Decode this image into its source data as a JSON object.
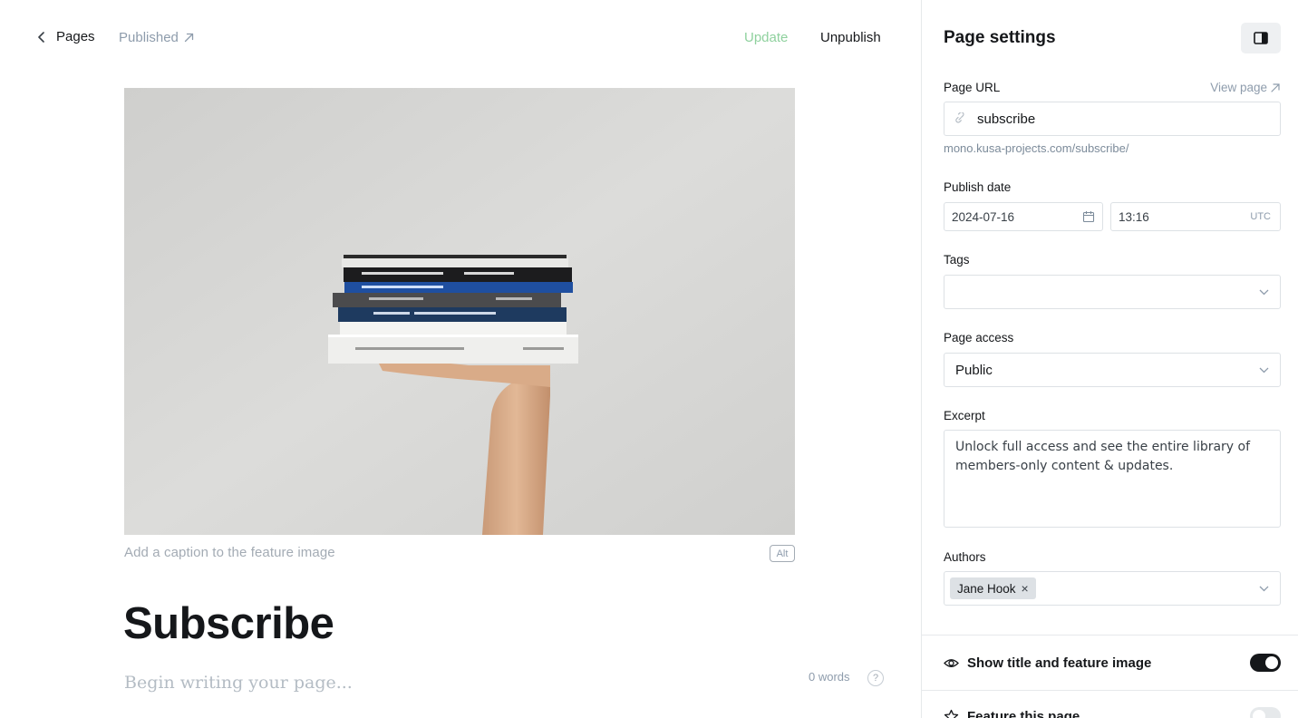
{
  "header": {
    "back_label": "Pages",
    "status_label": "Published",
    "update_label": "Update",
    "unpublish_label": "Unpublish"
  },
  "editor": {
    "caption_placeholder": "Add a caption to the feature image",
    "alt_label": "Alt",
    "title": "Subscribe",
    "body_placeholder": "Begin writing your page...",
    "word_count": "0 words",
    "help_label": "?"
  },
  "settings": {
    "title": "Page settings",
    "page_url_label": "Page URL",
    "view_page_label": "View page",
    "page_url_value": "subscribe",
    "page_url_full": "mono.kusa-projects.com/subscribe/",
    "publish_date_label": "Publish date",
    "publish_date": "2024-07-16",
    "publish_time": "13:16",
    "timezone": "UTC",
    "tags_label": "Tags",
    "tags_value": "",
    "page_access_label": "Page access",
    "page_access_value": "Public",
    "excerpt_label": "Excerpt",
    "excerpt_value": "Unlock full access and see the entire library of members-only content & updates.",
    "authors_label": "Authors",
    "authors": [
      "Jane Hook"
    ],
    "remove_author_glyph": "×",
    "show_title_label": "Show title and feature image",
    "show_title_on": true,
    "feature_page_label": "Feature this page",
    "feature_page_on": false
  },
  "colors": {
    "update_accent": "#8fd19e",
    "muted_text": "#8e9cac",
    "toggle_on": "#15171a",
    "toggle_off": "#e6e9eb"
  },
  "icons": {
    "back": "chevron-left-icon",
    "status_external": "arrow-up-right-icon",
    "panel_toggle": "sidebar-icon",
    "url_field": "link-icon",
    "date_field": "calendar-icon",
    "select": "chevron-down-icon",
    "show_title": "eye-icon",
    "feature": "star-icon"
  }
}
